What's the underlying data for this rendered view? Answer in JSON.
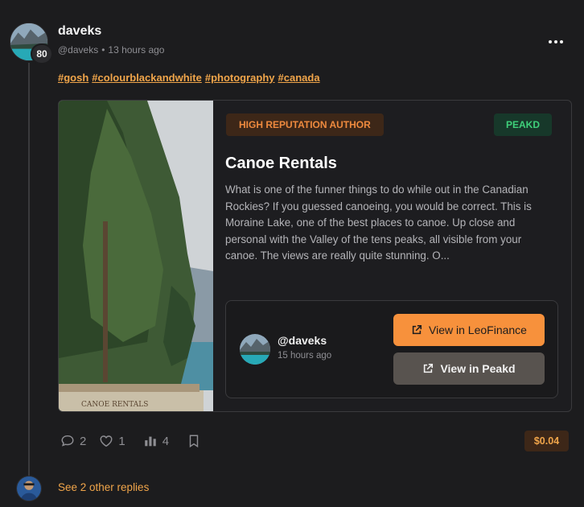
{
  "post": {
    "author": "daveks",
    "reputation": "80",
    "handle": "@daveks",
    "separator": "•",
    "time": "13 hours ago",
    "tags": [
      "#gosh",
      "#colourblackandwhite",
      "#photography",
      "#canada"
    ]
  },
  "card": {
    "reputation_badge": "HIGH REPUTATION AUTHOR",
    "platform_badge": "PEAKD",
    "title": "Canoe Rentals",
    "excerpt": "What is one of the funner things to do while out in the Canadian Rockies? If you guessed canoeing, you would be correct. This is Moraine Lake, one of the best places to canoe. Up close and personal with the Valley of the tens peaks, all visible from your canoe. The views are really quite stunning. O...",
    "image_sign_text": "CANOE RENTALS",
    "author_box": {
      "handle": "@daveks",
      "time": "15 hours ago",
      "leo_button": "View in LeoFinance",
      "peakd_button": "View in Peakd"
    }
  },
  "actions": {
    "comments": "2",
    "likes": "1",
    "votes": "4",
    "payout": "$0.04"
  },
  "replies": {
    "label": "See 2 other replies"
  },
  "colors": {
    "accent": "#f0a54a",
    "leo_button": "#f7913c",
    "peakd_badge": "#3fcf7a"
  }
}
